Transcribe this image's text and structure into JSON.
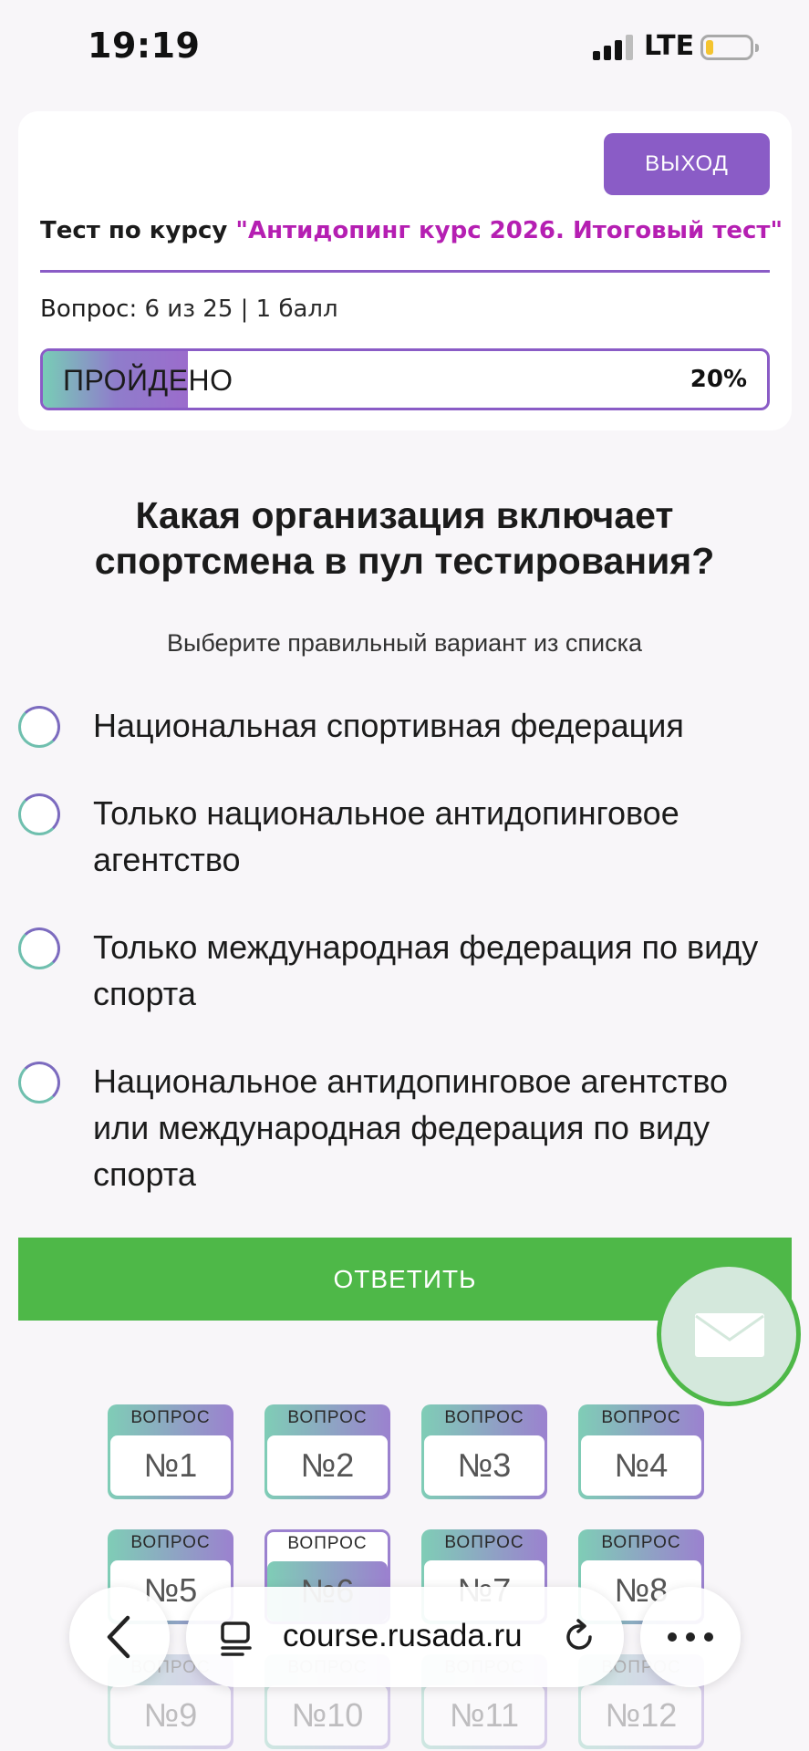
{
  "status_bar": {
    "time": "19:19",
    "network": "LTE"
  },
  "header": {
    "exit_label": "ВЫХОД",
    "course_prefix": "Тест по курсу",
    "course_name": "\"Антидопинг курс 2026. Итоговый тест\"",
    "question_label": "Вопрос:",
    "question_info": "6 из 25 | 1 балл",
    "progress_label": "ПРОЙДЕНО",
    "progress_percent": "20%",
    "progress_value": 20
  },
  "question": {
    "title": "Какая организация включает спортсмена в пул тестирования?",
    "hint": "Выберите правильный вариант из списка",
    "options": [
      "Национальная спортивная федерация",
      "Только национальное антидопинговое агентство",
      "Только международная федерация по виду спорта",
      "Национальное антидопинговое агентство или международная федерация по виду спорта"
    ],
    "submit_label": "ОТВЕТИТЬ"
  },
  "question_grid": {
    "cell_label": "ВОПРОС",
    "numbers": [
      "№1",
      "№2",
      "№3",
      "№4",
      "№5",
      "№6",
      "№7",
      "№8",
      "№9",
      "№10",
      "№11",
      "№12"
    ],
    "current_index": 5
  },
  "browser": {
    "url": "course.rusada.ru"
  },
  "colors": {
    "accent": "#8a5cc6",
    "course_name": "#b51fb2",
    "submit": "#4eb848"
  },
  "icons": [
    "back-chevron-icon",
    "page-menu-icon",
    "reload-icon",
    "more-dots-icon",
    "mail-icon"
  ]
}
